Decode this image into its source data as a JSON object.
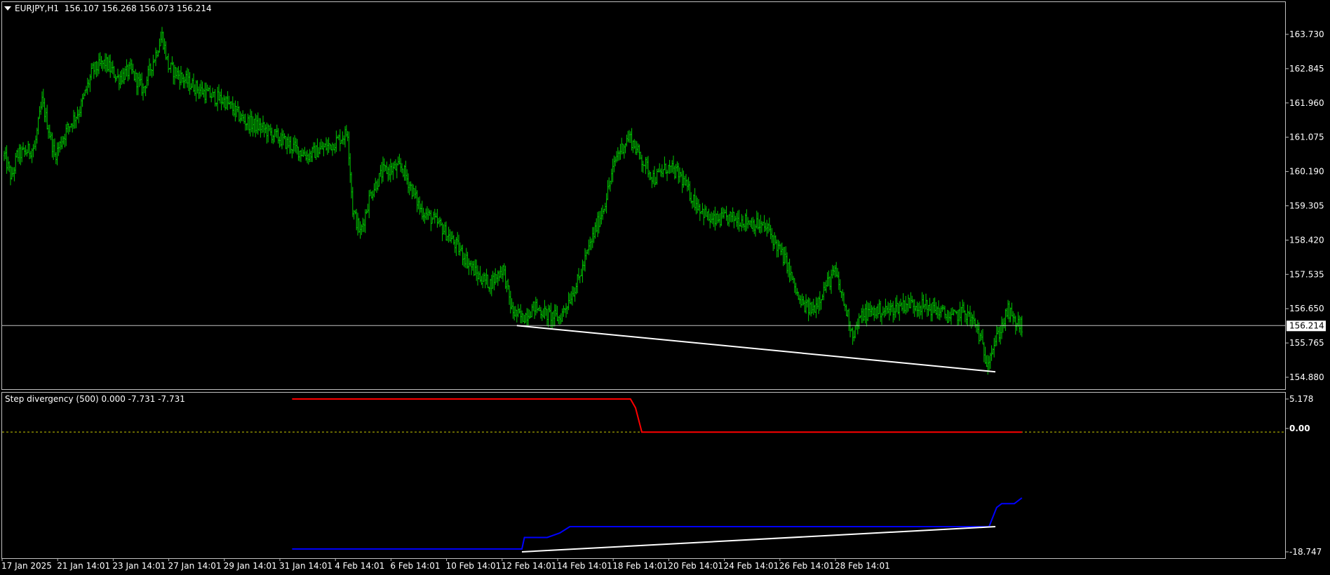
{
  "header": {
    "symbol": "EURJPY,H1",
    "ohlc": "156.107 156.268 156.073 156.214"
  },
  "indicator": {
    "title": "Step divergency (500) 0.000 -7.731 -7.731"
  },
  "colors": {
    "background": "#000000",
    "frame": "#c0c0c0",
    "bars": "#00c800",
    "bid_line": "#c0c0c0",
    "divergence_line": "#ffffff",
    "red_line": "#ff0000",
    "blue_line": "#0000ff",
    "zero_line": "#c8c800"
  },
  "price_axis": [
    "163.730",
    "162.845",
    "161.960",
    "161.075",
    "160.190",
    "159.305",
    "158.420",
    "157.535",
    "156.650",
    "155.765",
    "154.880"
  ],
  "current_price": "156.214",
  "indicator_axis": {
    "top": "5.178",
    "zero": "0.00",
    "bottom": "-18.747"
  },
  "time_axis": [
    "17 Jan 2025",
    "21 Jan 14:01",
    "23 Jan 14:01",
    "27 Jan 14:01",
    "29 Jan 14:01",
    "31 Jan 14:01",
    "4 Feb 14:01",
    "6 Feb 14:01",
    "10 Feb 14:01",
    "12 Feb 14:01",
    "14 Feb 14:01",
    "18 Feb 14:01",
    "20 Feb 14:01",
    "24 Feb 14:01",
    "26 Feb 14:01",
    "28 Feb 14:01"
  ],
  "chart_data": {
    "type": "line",
    "price_scale": {
      "min": 154.0,
      "max": 164.5
    },
    "indicator_scale": {
      "min": -18.747,
      "max": 5.178
    },
    "price_keypoints": [
      [
        0,
        160.6
      ],
      [
        6,
        160.0
      ],
      [
        10,
        160.6
      ],
      [
        24,
        160.8
      ],
      [
        30,
        162.0
      ],
      [
        40,
        160.6
      ],
      [
        50,
        161.3
      ],
      [
        60,
        161.8
      ],
      [
        70,
        162.8
      ],
      [
        80,
        163.0
      ],
      [
        90,
        162.6
      ],
      [
        100,
        162.8
      ],
      [
        110,
        162.3
      ],
      [
        125,
        163.7
      ],
      [
        130,
        162.9
      ],
      [
        145,
        162.5
      ],
      [
        160,
        162.2
      ],
      [
        175,
        162.0
      ],
      [
        190,
        161.5
      ],
      [
        205,
        161.3
      ],
      [
        220,
        161.0
      ],
      [
        240,
        160.6
      ],
      [
        260,
        160.9
      ],
      [
        272,
        161.2
      ],
      [
        276,
        159.2
      ],
      [
        282,
        158.6
      ],
      [
        290,
        159.6
      ],
      [
        300,
        160.2
      ],
      [
        315,
        160.3
      ],
      [
        330,
        159.2
      ],
      [
        345,
        158.8
      ],
      [
        360,
        158.2
      ],
      [
        375,
        157.5
      ],
      [
        385,
        157.3
      ],
      [
        395,
        157.7
      ],
      [
        402,
        156.6
      ],
      [
        410,
        156.4
      ],
      [
        420,
        156.7
      ],
      [
        430,
        156.5
      ],
      [
        440,
        156.4
      ],
      [
        455,
        157.4
      ],
      [
        465,
        158.4
      ],
      [
        475,
        159.3
      ],
      [
        485,
        160.6
      ],
      [
        495,
        161.1
      ],
      [
        505,
        160.5
      ],
      [
        515,
        160.0
      ],
      [
        525,
        160.3
      ],
      [
        535,
        160.1
      ],
      [
        545,
        159.5
      ],
      [
        560,
        158.9
      ],
      [
        575,
        159.0
      ],
      [
        590,
        158.9
      ],
      [
        605,
        158.7
      ],
      [
        620,
        157.8
      ],
      [
        630,
        156.8
      ],
      [
        640,
        156.6
      ],
      [
        650,
        157.2
      ],
      [
        658,
        157.6
      ],
      [
        665,
        156.8
      ],
      [
        672,
        156.0
      ],
      [
        680,
        156.5
      ],
      [
        690,
        156.6
      ],
      [
        700,
        156.6
      ],
      [
        715,
        156.8
      ],
      [
        730,
        156.7
      ],
      [
        740,
        156.6
      ],
      [
        750,
        156.4
      ],
      [
        760,
        156.6
      ],
      [
        770,
        156.2
      ],
      [
        778,
        155.3
      ],
      [
        785,
        155.8
      ],
      [
        795,
        156.6
      ],
      [
        800,
        156.3
      ],
      [
        806,
        156.2
      ]
    ],
    "red_series": [
      [
        228,
        5.178
      ],
      [
        496,
        5.178
      ],
      [
        500,
        3.8
      ],
      [
        505,
        0.0
      ],
      [
        806,
        0.0
      ]
    ],
    "blue_series": [
      [
        228,
        -18.3
      ],
      [
        410,
        -18.3
      ],
      [
        412,
        -16.5
      ],
      [
        430,
        -16.5
      ],
      [
        440,
        -15.8
      ],
      [
        448,
        -14.8
      ],
      [
        780,
        -14.8
      ],
      [
        786,
        -11.8
      ],
      [
        790,
        -11.2
      ],
      [
        800,
        -11.2
      ],
      [
        806,
        -10.3
      ]
    ],
    "price_divergence_line": {
      "from": [
        406,
        156.214
      ],
      "to": [
        785,
        155.02
      ]
    },
    "indicator_divergence_line": {
      "from": [
        410,
        -18.747
      ],
      "to": [
        785,
        -14.8
      ]
    }
  }
}
